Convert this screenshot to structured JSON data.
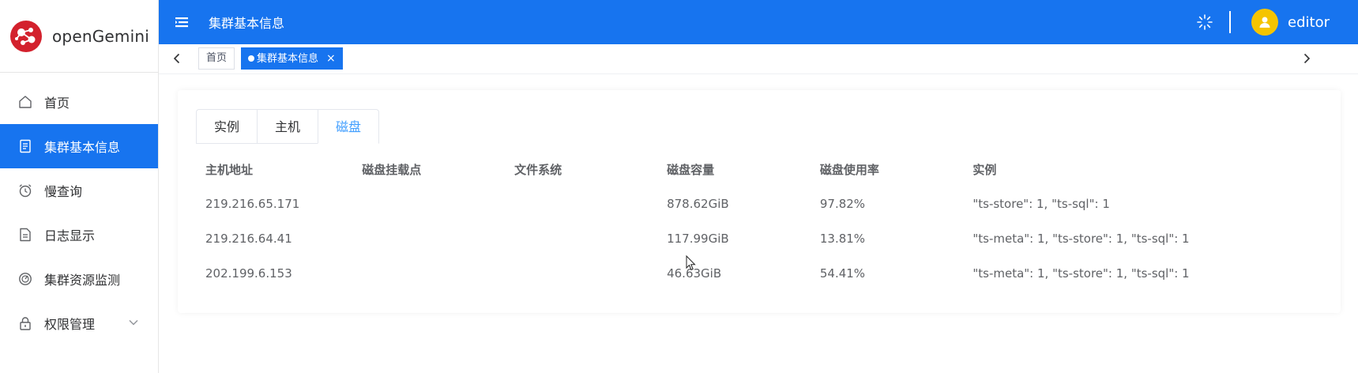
{
  "brand": {
    "name": "openGemini",
    "logo_color": "#d3212d"
  },
  "sidebar": {
    "items": [
      {
        "label": "首页",
        "icon": "home-icon"
      },
      {
        "label": "集群基本信息",
        "icon": "document-icon",
        "active": true
      },
      {
        "label": "慢查询",
        "icon": "alarm-clock-icon"
      },
      {
        "label": "日志显示",
        "icon": "file-text-icon"
      },
      {
        "label": "集群资源监测",
        "icon": "gauge-icon"
      },
      {
        "label": "权限管理",
        "icon": "lock-icon",
        "expandable": true
      }
    ]
  },
  "header": {
    "title": "集群基本信息",
    "username": "editor",
    "accent": "#1774ef"
  },
  "tags": {
    "home": "首页",
    "current": "集群基本信息",
    "close": "×"
  },
  "tabs": [
    {
      "label": "实例"
    },
    {
      "label": "主机"
    },
    {
      "label": "磁盘",
      "active": true
    }
  ],
  "table": {
    "columns": [
      "主机地址",
      "磁盘挂载点",
      "文件系统",
      "磁盘容量",
      "磁盘使用率",
      "实例"
    ],
    "rows": [
      [
        "219.216.65.171",
        "",
        "",
        "878.62GiB",
        "97.82%",
        "\"ts-store\": 1, \"ts-sql\": 1"
      ],
      [
        "219.216.64.41",
        "",
        "",
        "117.99GiB",
        "13.81%",
        "\"ts-meta\": 1, \"ts-store\": 1, \"ts-sql\": 1"
      ],
      [
        "202.199.6.153",
        "",
        "",
        "46.63GiB",
        "54.41%",
        "\"ts-meta\": 1, \"ts-store\": 1, \"ts-sql\": 1"
      ]
    ]
  }
}
